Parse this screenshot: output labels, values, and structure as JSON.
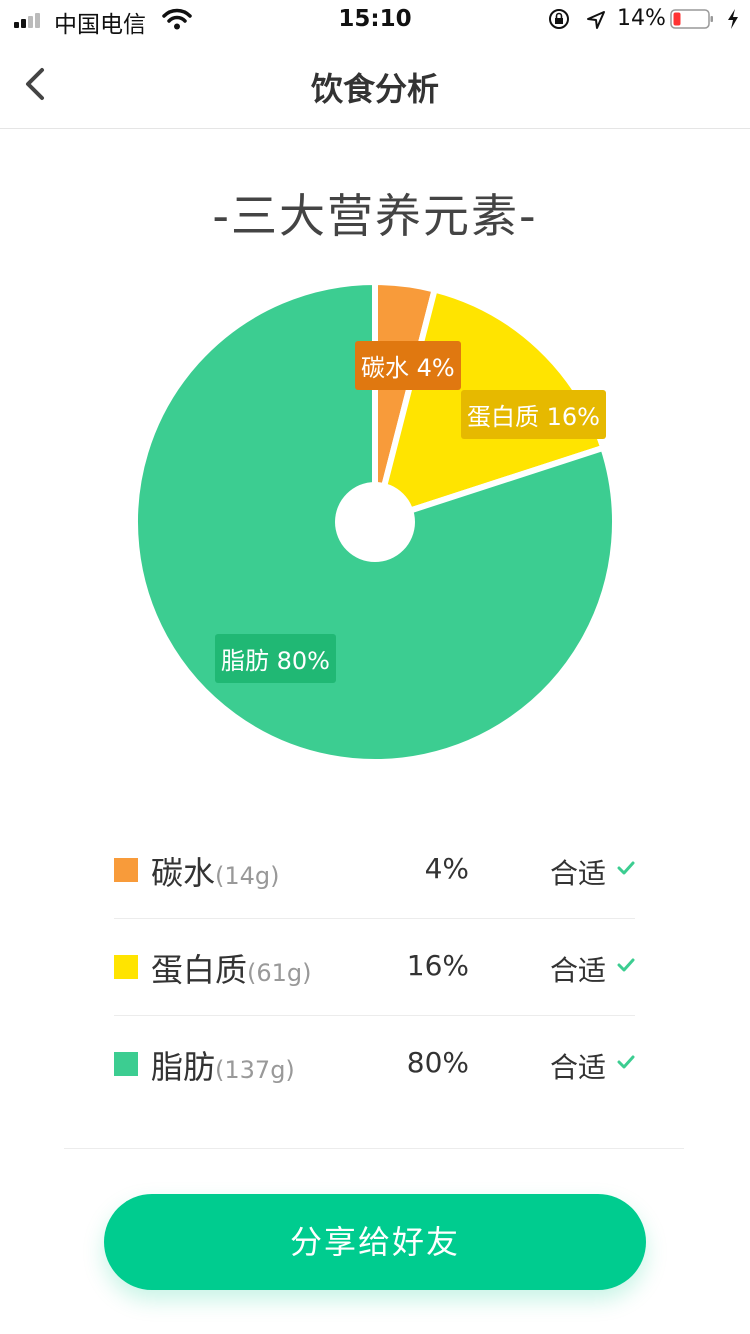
{
  "status_bar": {
    "carrier": "中国电信",
    "time": "15:10",
    "battery": "14%"
  },
  "nav": {
    "title": "饮食分析"
  },
  "section_title": "-三大营养元素-",
  "chart_data": {
    "type": "pie",
    "title": "-三大营养元素-",
    "categories": [
      "碳水",
      "蛋白质",
      "脂肪"
    ],
    "values": [
      4,
      16,
      80
    ],
    "colors": [
      "#f89b3a",
      "#ffe400",
      "#3ccd91"
    ],
    "labels": [
      "碳水 4%",
      "蛋白质 16%",
      "脂肪 80%"
    ]
  },
  "nutrients": [
    {
      "name": "碳水",
      "grams": "(14g)",
      "percent": "4%",
      "status": "合适",
      "color": "#f89b3a"
    },
    {
      "name": "蛋白质",
      "grams": "(61g)",
      "percent": "16%",
      "status": "合适",
      "color": "#ffe400"
    },
    {
      "name": "脂肪",
      "grams": "(137g)",
      "percent": "80%",
      "status": "合适",
      "color": "#3ccd91"
    }
  ],
  "share_button": "分享给好友"
}
